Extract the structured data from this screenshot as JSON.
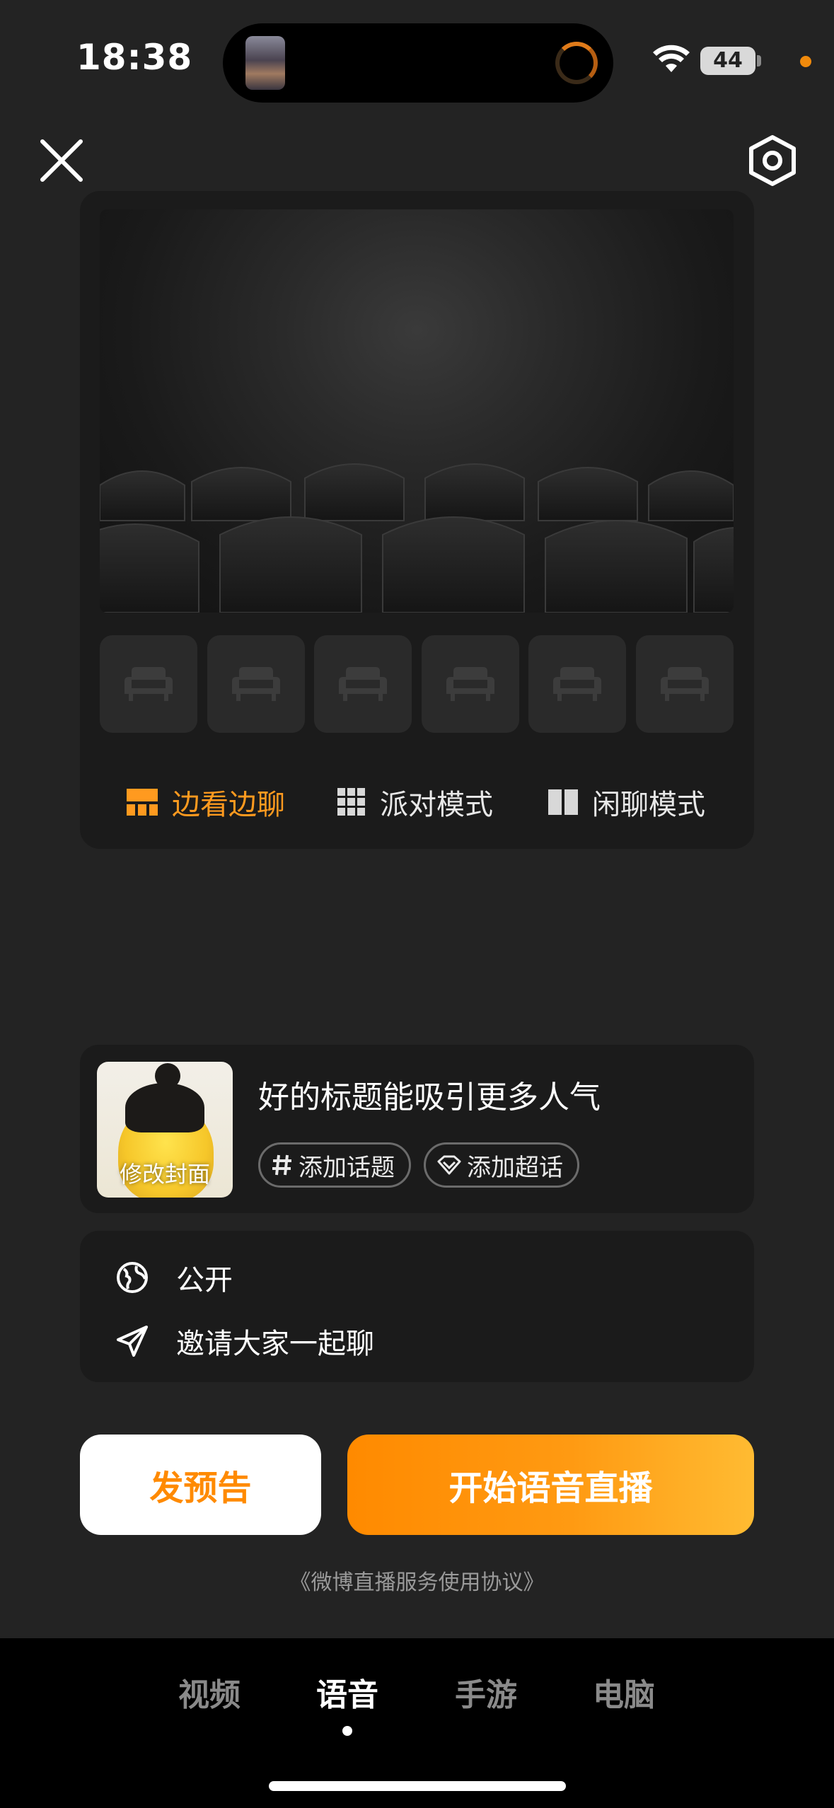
{
  "status_bar": {
    "time": "18:38",
    "battery_level": "44",
    "icons": [
      "wifi-icon",
      "battery-icon",
      "recording-dot"
    ]
  },
  "header": {
    "close_icon": "close-icon",
    "settings_icon": "hexagon-settings-icon"
  },
  "modes": [
    {
      "label": "边看边聊",
      "icon": "watch-chat-icon",
      "active": true
    },
    {
      "label": "派对模式",
      "icon": "grid-icon",
      "active": false
    },
    {
      "label": "闲聊模式",
      "icon": "split-icon",
      "active": false
    }
  ],
  "seat_count": 6,
  "title_card": {
    "cover_label": "修改封面",
    "title_placeholder": "好的标题能吸引更多人气",
    "add_topic": "添加话题",
    "add_super_topic": "添加超话"
  },
  "visibility": {
    "public_label": "公开",
    "invite_label": "邀请大家一起聊"
  },
  "actions": {
    "preview_button": "发预告",
    "start_button": "开始语音直播"
  },
  "agreement": "《微博直播服务使用协议》",
  "tabs": [
    {
      "label": "视频",
      "active": false
    },
    {
      "label": "语音",
      "active": true
    },
    {
      "label": "手游",
      "active": false
    },
    {
      "label": "电脑",
      "active": false
    }
  ],
  "colors": {
    "accent": "#ff9a1f",
    "background": "#232323",
    "card": "#1b1b1b"
  }
}
